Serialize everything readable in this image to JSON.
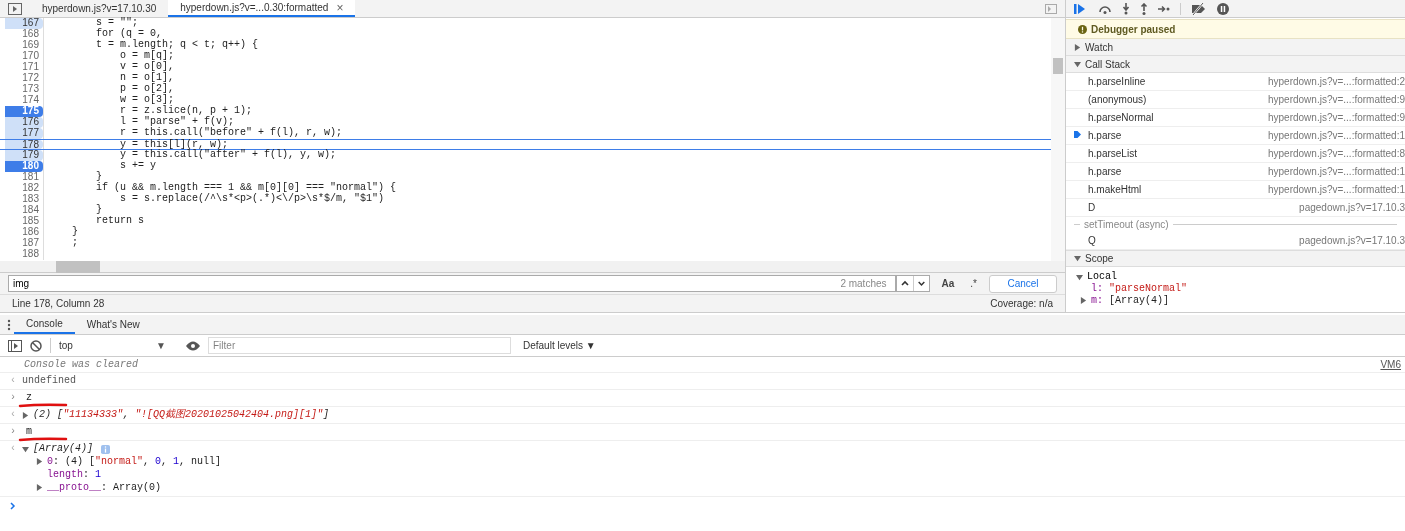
{
  "editor_tabs": [
    {
      "label": "hyperdown.js?v=17.10.30",
      "selected": false,
      "closable": false
    },
    {
      "label": "hyperdown.js?v=...0.30:formatted",
      "selected": true,
      "closable": true
    }
  ],
  "close_glyph": "×",
  "code_lines": [
    {
      "number": "167",
      "code": "        s = \"\";",
      "breakpoint": true,
      "disabled": true,
      "current": false
    },
    {
      "number": "168",
      "code": "        for (q = 0,",
      "breakpoint": false,
      "current": false
    },
    {
      "number": "169",
      "code": "        t = m.length; q < t; q++) {",
      "breakpoint": false,
      "current": false
    },
    {
      "number": "170",
      "code": "            o = m[q];",
      "breakpoint": false,
      "current": false
    },
    {
      "number": "171",
      "code": "            v = o[0],",
      "breakpoint": false,
      "current": false
    },
    {
      "number": "172",
      "code": "            n = o[1],",
      "breakpoint": false,
      "current": false
    },
    {
      "number": "173",
      "code": "            p = o[2],",
      "breakpoint": false,
      "current": false
    },
    {
      "number": "174",
      "code": "            w = o[3];",
      "breakpoint": false,
      "current": false
    },
    {
      "number": "175",
      "code": "            r = z.slice(n, p + 1);",
      "breakpoint": true,
      "disabled": false,
      "current": false
    },
    {
      "number": "176",
      "code": "            l = \"parse\" + f(v);",
      "breakpoint": true,
      "disabled": true,
      "current": false
    },
    {
      "number": "177",
      "code": "            r = this.call(\"before\" + f(l), r, w);",
      "breakpoint": true,
      "disabled": true,
      "current": false
    },
    {
      "number": "178",
      "code": "            y = this[l](r, w);",
      "breakpoint": true,
      "disabled": true,
      "current": true
    },
    {
      "number": "179",
      "code": "            y = this.call(\"after\" + f(l), y, w);",
      "breakpoint": true,
      "disabled": true,
      "current": false
    },
    {
      "number": "180",
      "code": "            s += y",
      "breakpoint": true,
      "disabled": false,
      "current": false
    },
    {
      "number": "181",
      "code": "        }",
      "breakpoint": false,
      "current": false
    },
    {
      "number": "182",
      "code": "        if (u && m.length === 1 && m[0][0] === \"normal\") {",
      "breakpoint": false,
      "current": false
    },
    {
      "number": "183",
      "code": "            s = s.replace(/^\\s*<p>(.*)<\\/p>\\s*$/m, \"$1\")",
      "breakpoint": false,
      "current": false
    },
    {
      "number": "184",
      "code": "        }",
      "breakpoint": false,
      "current": false
    },
    {
      "number": "185",
      "code": "        return s",
      "breakpoint": false,
      "current": false
    },
    {
      "number": "186",
      "code": "    }",
      "breakpoint": false,
      "current": false
    },
    {
      "number": "187",
      "code": "    ;",
      "breakpoint": false,
      "current": false
    },
    {
      "number": "188",
      "breakpoint": false,
      "current": false
    }
  ],
  "search": {
    "value": "img",
    "matches": "2 matches",
    "case_button": "Aa",
    "regex_button": ".*",
    "cancel": "Cancel"
  },
  "status_bar": {
    "position": "Line 178, Column 28",
    "coverage": "Coverage: n/a"
  },
  "debugger": {
    "banner": "Debugger paused",
    "sections": [
      {
        "title": "Watch",
        "expanded": false
      },
      {
        "title": "Call Stack",
        "expanded": true
      }
    ],
    "call_stack": [
      {
        "kind": "frame",
        "name": "h.parseInline",
        "location": "hyperdown.js?v=...:formatted:2",
        "selected": false
      },
      {
        "kind": "frame",
        "name": "(anonymous)",
        "location": "hyperdown.js?v=...:formatted:9",
        "selected": false
      },
      {
        "kind": "frame",
        "name": "h.parseNormal",
        "location": "hyperdown.js?v=...:formatted:9",
        "selected": false
      },
      {
        "kind": "frame",
        "name": "h.parse",
        "location": "hyperdown.js?v=...:formatted:1",
        "selected": true
      },
      {
        "kind": "frame",
        "name": "h.parseList",
        "location": "hyperdown.js?v=...:formatted:8",
        "selected": false
      },
      {
        "kind": "frame",
        "name": "h.parse",
        "location": "hyperdown.js?v=...:formatted:1",
        "selected": false
      },
      {
        "kind": "frame",
        "name": "h.makeHtml",
        "location": "hyperdown.js?v=...:formatted:1",
        "selected": false
      },
      {
        "kind": "frame",
        "name": "D",
        "location": "pagedown.js?v=17.10.3",
        "selected": false
      },
      {
        "kind": "async",
        "name": "setTimeout (async)"
      },
      {
        "kind": "frame",
        "name": "Q",
        "location": "pagedown.js?v=17.10.3",
        "selected": false
      }
    ],
    "scope": {
      "title": "Scope",
      "expanded": true,
      "local": "Local",
      "vars": [
        {
          "key": "l",
          "separator": ":",
          "value": "\"parseNormal\"",
          "expandable": false
        },
        {
          "key": "m",
          "separator": ":",
          "value": "[Array(4)]",
          "expandable": true
        }
      ]
    }
  },
  "drawer_tabs": [
    {
      "label": "Console",
      "selected": true
    },
    {
      "label": "What's New",
      "selected": false
    }
  ],
  "console_toolbar": {
    "context": "top",
    "filter_placeholder": "Filter",
    "levels": "Default levels ▼",
    "dropdown_glyph": "▼"
  },
  "console": [
    {
      "kind": "info",
      "text": "Console was cleared",
      "source": "VM6"
    },
    {
      "kind": "result",
      "marker": "‹",
      "parts": [
        {
          "t": "undefined",
          "kind": "gray"
        }
      ]
    },
    {
      "kind": "input",
      "marker": "›",
      "text": "z",
      "marked": true
    },
    {
      "kind": "result",
      "marker": "‹",
      "expandable": true,
      "italic": true,
      "parts": [
        {
          "t": "(2) [",
          "kind": "plain"
        },
        {
          "t": "\"11134333\"",
          "kind": "string"
        },
        {
          "t": ", ",
          "kind": "plain"
        },
        {
          "t": "\"![QQ截图20201025042404.png][1]\"",
          "kind": "string"
        },
        {
          "t": "]",
          "kind": "plain"
        }
      ]
    },
    {
      "kind": "input",
      "marker": "›",
      "text": "m",
      "marked": true
    },
    {
      "kind": "result",
      "marker": "‹",
      "expandable": true,
      "expanded": true,
      "italic": true,
      "info_badge": true,
      "parts": [
        {
          "t": "[Array(4)]",
          "kind": "plain"
        }
      ],
      "children": [
        {
          "expandable": true,
          "parts": [
            {
              "t": "0",
              "kind": "key"
            },
            {
              "t": ": (4) [",
              "kind": "plain"
            },
            {
              "t": "\"normal\"",
              "kind": "string"
            },
            {
              "t": ", ",
              "kind": "plain"
            },
            {
              "t": "0",
              "kind": "number"
            },
            {
              "t": ", ",
              "kind": "plain"
            },
            {
              "t": "1",
              "kind": "number"
            },
            {
              "t": ", null]",
              "kind": "plain"
            }
          ]
        },
        {
          "expandable": false,
          "parts": [
            {
              "t": "length",
              "kind": "key"
            },
            {
              "t": ": ",
              "kind": "plain"
            },
            {
              "t": "1",
              "kind": "number"
            }
          ]
        },
        {
          "expandable": true,
          "parts": [
            {
              "t": "__proto__",
              "kind": "key"
            },
            {
              "t": ": Array(0)",
              "kind": "plain"
            }
          ]
        }
      ]
    },
    {
      "kind": "prompt"
    }
  ]
}
